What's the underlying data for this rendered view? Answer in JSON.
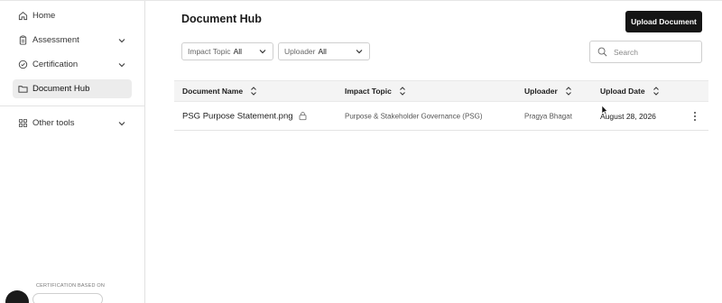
{
  "sidebar": {
    "items": [
      {
        "label": "Home",
        "icon": "home-icon"
      },
      {
        "label": "Assessment",
        "icon": "clipboard-icon",
        "expandable": true
      },
      {
        "label": "Certification",
        "icon": "check-circle-icon",
        "expandable": true
      },
      {
        "label": "Document Hub",
        "icon": "folder-icon",
        "active": true
      }
    ],
    "other_tools": {
      "label": "Other tools",
      "icon": "grid-icon",
      "expandable": true
    },
    "footer": {
      "cert_text": "CERTIFICATION BASED ON"
    }
  },
  "main": {
    "title": "Document Hub",
    "upload_label": "Upload Document",
    "filters": [
      {
        "label": "Impact Topic",
        "value": "All"
      },
      {
        "label": "Uploader",
        "value": "All"
      }
    ],
    "search": {
      "placeholder": "Search"
    },
    "table": {
      "columns": [
        "Document Name",
        "Impact Topic",
        "Uploader",
        "Upload Date"
      ],
      "rows": [
        {
          "name": "PSG Purpose Statement.png",
          "topic": "Purpose & Stakeholder Governance (PSG)",
          "uploader": "Pragya Bhagat",
          "date": "August 28, 2026"
        }
      ]
    }
  },
  "colors": {
    "accent": "#151515",
    "active_bg": "#ececec",
    "header_bg": "#f4f4f4"
  }
}
